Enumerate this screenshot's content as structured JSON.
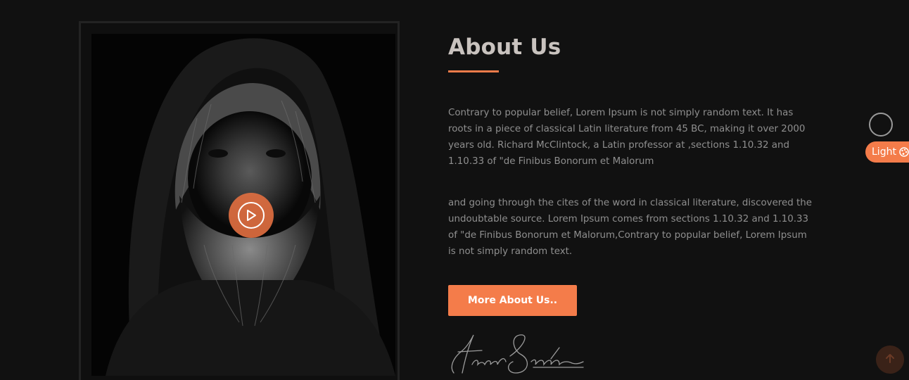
{
  "about": {
    "title": "About Us",
    "paragraph_1": "Contrary to popular belief, Lorem Ipsum is not simply random text. It has roots in a piece of classical Latin literature from 45 BC, making it over 2000 years old. Richard McClintock, a Latin professor at ,sections 1.10.32 and 1.10.33 of \"de Finibus Bonorum et Malorum",
    "paragraph_2": "and going through the cites of the word in classical literature, discovered the undoubtable source. Lorem Ipsum comes from sections 1.10.32 and 1.10.33 of \"de Finibus Bonorum et Malorum,Contrary to popular belief, Lorem Ipsum is not simply random text.",
    "button_label": "More About Us..",
    "signature_text": "Frank Sinatra"
  },
  "widgets": {
    "theme_toggle_label": "Light"
  },
  "icons": {
    "play": "play-icon",
    "palette": "palette-icon",
    "scroll_top": "arrow-up-icon"
  },
  "colors": {
    "background": "#111111",
    "accent": "#f47c4a",
    "title": "#c9c3bf",
    "body_text": "#8f8f8f"
  }
}
